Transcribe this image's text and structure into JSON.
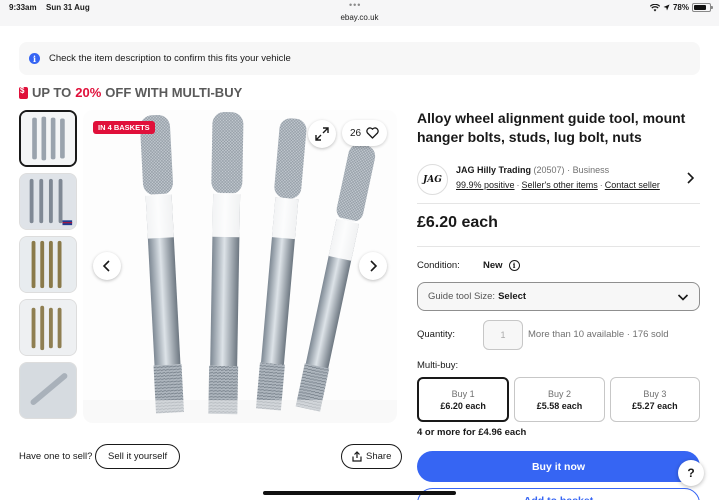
{
  "status_bar": {
    "time": "9:33am",
    "date": "Sun 31 Aug",
    "url": "ebay.co.uk",
    "battery": "78%",
    "battery_level": 0.78
  },
  "banner": {
    "text": "Check the item description to confirm this fits your vehicle",
    "icon": "info-icon"
  },
  "promo": {
    "prefix": "UP TO",
    "highlight": "20%",
    "suffix": "OFF WITH MULTI-BUY"
  },
  "gallery": {
    "badge": "IN 4 BASKETS",
    "watch_count": "26",
    "thumbnail_count": 5,
    "selected_index": 0
  },
  "sell": {
    "question": "Have one to sell?",
    "sell_button": "Sell it yourself",
    "share_button": "Share"
  },
  "listing": {
    "title": "Alloy wheel alignment guide tool, mount hanger bolts, studs, lug bolt, nuts",
    "price": "£6.20 each"
  },
  "seller": {
    "logo_text": "JAG",
    "name": "JAG Hilly Trading",
    "feedback_count": "(20507)",
    "type": "· Business",
    "positive": "99.9% positive",
    "other_items": "Seller's other items",
    "contact": "Contact seller"
  },
  "condition": {
    "label": "Condition:",
    "value": "New"
  },
  "variant_select": {
    "label": "Guide tool Size:",
    "value": "Select"
  },
  "quantity": {
    "label": "Quantity:",
    "value": "1",
    "availability": "More than 10 available · 176 sold"
  },
  "multibuy": {
    "label": "Multi-buy:",
    "options": [
      {
        "title": "Buy 1",
        "price": "£6.20 each"
      },
      {
        "title": "Buy 2",
        "price": "£5.58 each"
      },
      {
        "title": "Buy 3",
        "price": "£5.27 each"
      }
    ],
    "more": "4 or more for £4.96 each"
  },
  "actions": {
    "buy_now": "Buy it now",
    "add_to_basket": "Add to basket",
    "help": "?"
  },
  "colors": {
    "accent_blue": "#3665f3",
    "promo_red": "#e0103a"
  }
}
